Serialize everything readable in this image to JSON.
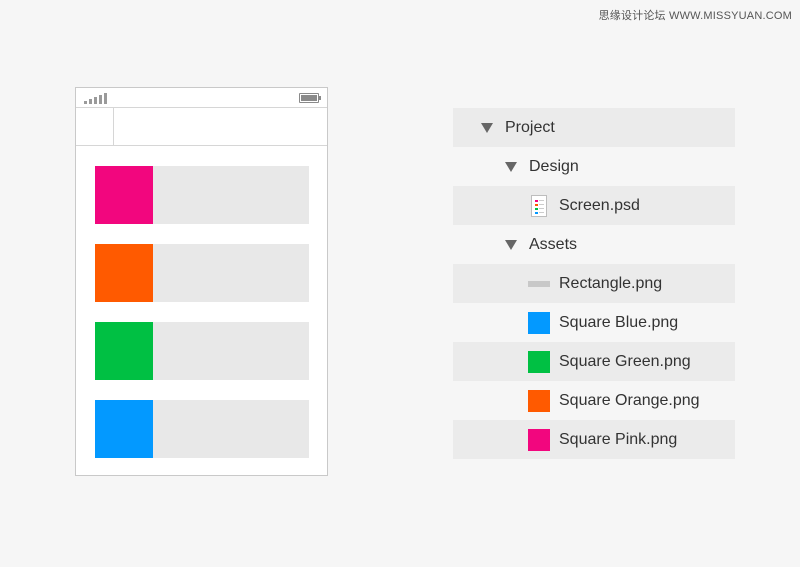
{
  "watermark": "思缘设计论坛 WWW.MISSYUAN.COM",
  "phone": {
    "rows": [
      {
        "color": "#f2067e"
      },
      {
        "color": "#ff5a00"
      },
      {
        "color": "#00c043"
      },
      {
        "color": "#0399ff"
      }
    ]
  },
  "layers": {
    "project": "Project",
    "design": "Design",
    "screen": "Screen.psd",
    "assets": "Assets",
    "rectangle": "Rectangle.png",
    "blue": "Square Blue.png",
    "green": "Square Green.png",
    "orange": "Square Orange.png",
    "pink": "Square Pink.png"
  },
  "colors": {
    "blue": "#0399ff",
    "green": "#00c043",
    "orange": "#ff5a00",
    "pink": "#f2067e"
  }
}
